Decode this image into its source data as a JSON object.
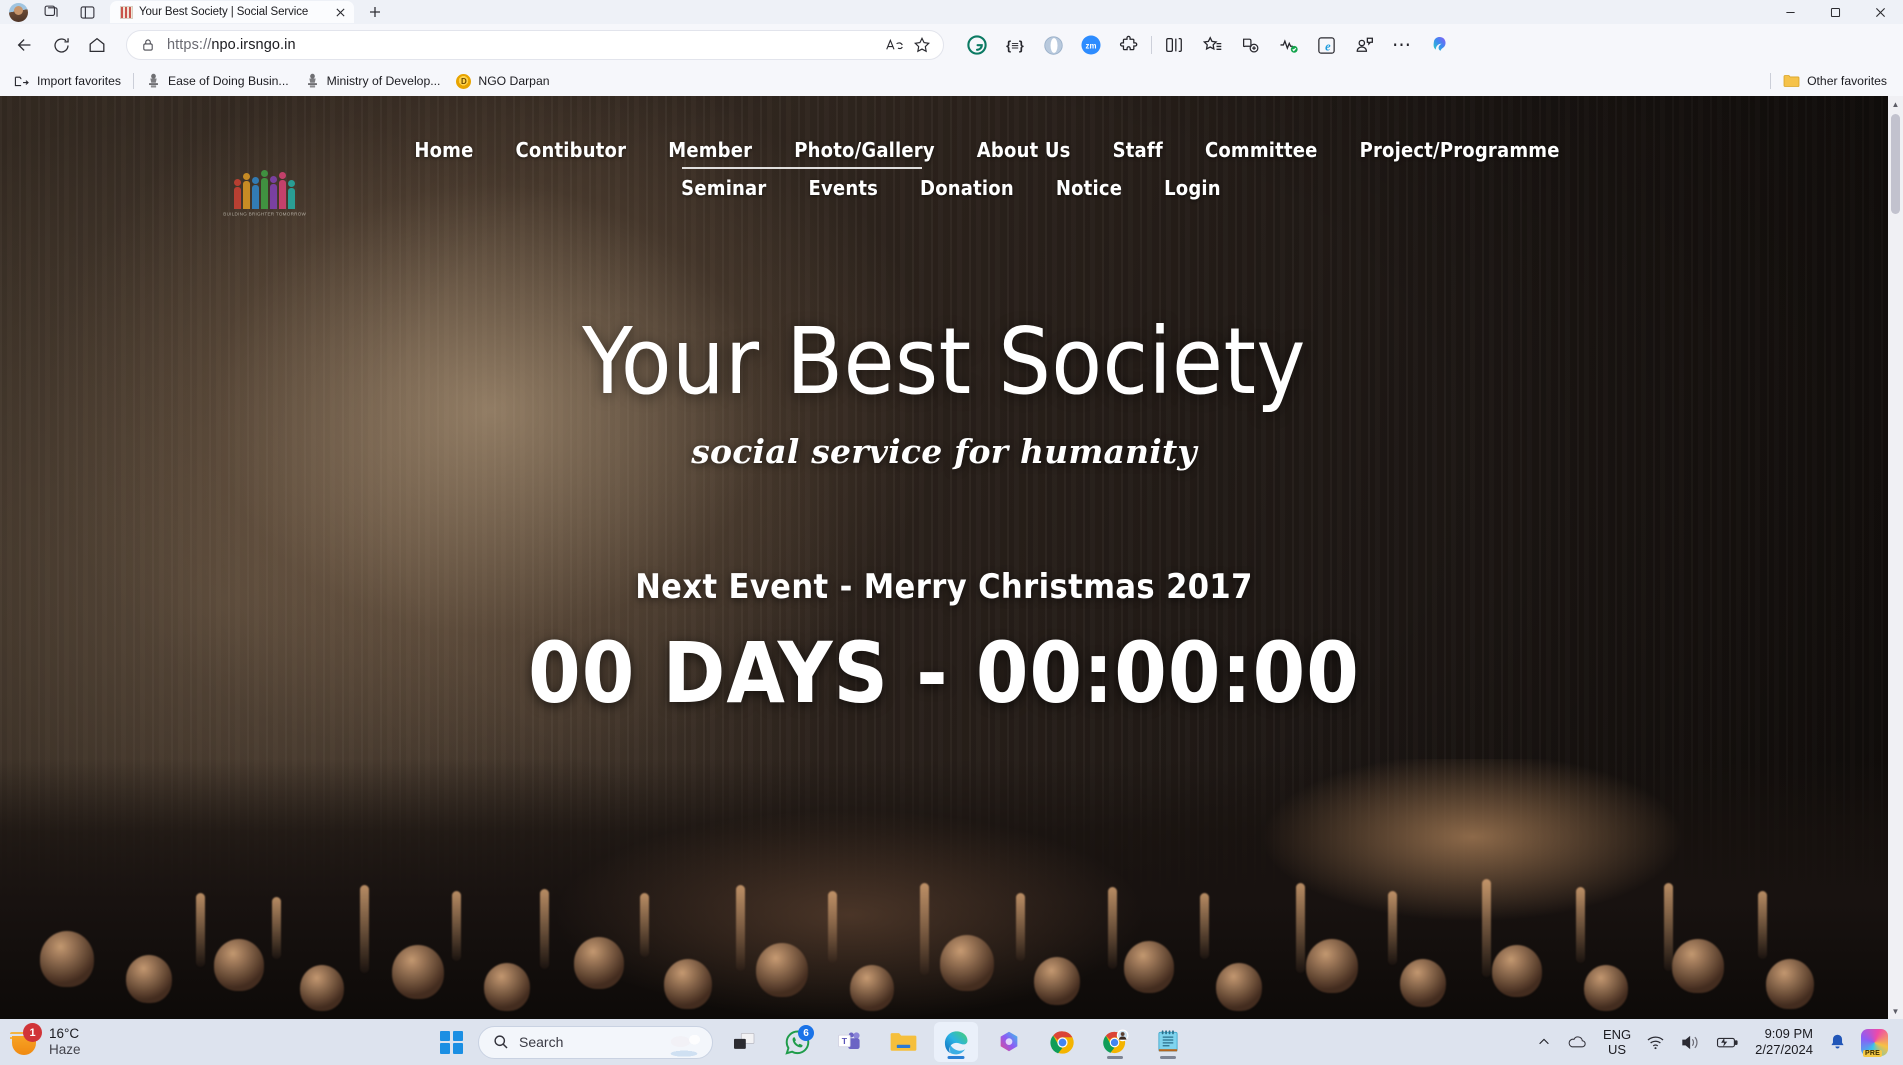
{
  "browser": {
    "tab": {
      "title": "Your Best Society | Social Service",
      "favicon": "site-favicon"
    },
    "new_tab_label": "+",
    "window_controls": {
      "minimize": "—",
      "maximize": "☐",
      "close": "✕"
    },
    "address": {
      "url_scheme": "https://",
      "url_host": "npo.irsngo.in",
      "full": "https://npo.irsngo.in",
      "lock": "site-lock-icon"
    },
    "omnibox_actions": [
      {
        "name": "read-aloud-icon",
        "label": "Aᴺ"
      },
      {
        "name": "add-favorite-icon",
        "label": "☆"
      }
    ],
    "extensions": [
      {
        "name": "grammarly-extension",
        "label": "G"
      },
      {
        "name": "json-formatter-extension",
        "label": "{≡}"
      },
      {
        "name": "blue-circle-extension",
        "label": ""
      },
      {
        "name": "zoom-extension",
        "label": "zm"
      },
      {
        "name": "extensions-puzzle-icon",
        "label": ""
      },
      {
        "name": "split-screen-icon",
        "label": ""
      },
      {
        "name": "favorites-icon",
        "label": ""
      },
      {
        "name": "collections-icon",
        "label": ""
      },
      {
        "name": "browser-essentials-icon",
        "label": ""
      },
      {
        "name": "ie-mode-icon",
        "label": "e"
      },
      {
        "name": "profile-icon",
        "label": ""
      },
      {
        "name": "settings-more-icon",
        "label": "⋯"
      },
      {
        "name": "copilot-icon",
        "label": ""
      }
    ],
    "bookmarks": {
      "items": [
        {
          "label": "Import favorites",
          "icon": "import-favorites-icon"
        },
        {
          "label": "Ease of Doing Busin...",
          "icon": "emblem-of-india-icon"
        },
        {
          "label": "Ministry of Develop...",
          "icon": "emblem-of-india-icon"
        },
        {
          "label": "NGO Darpan",
          "icon": "ngo-darpan-icon"
        }
      ],
      "other_favorites": {
        "label": "Other favorites",
        "icon": "folder-icon"
      }
    }
  },
  "site": {
    "logo_caption": "BUILDING BRIGHTER TOMORROW",
    "nav_row1": [
      {
        "label": "Home"
      },
      {
        "label": "Contibutor"
      },
      {
        "label": "Member"
      },
      {
        "label": "Photo/Gallery"
      },
      {
        "label": "About Us"
      },
      {
        "label": "Staff"
      },
      {
        "label": "Committee"
      },
      {
        "label": "Project/Programme"
      }
    ],
    "nav_row2": [
      {
        "label": "Seminar"
      },
      {
        "label": "Events"
      },
      {
        "label": "Donation"
      },
      {
        "label": "Notice"
      },
      {
        "label": "Login"
      }
    ],
    "hero": {
      "title": "Your Best Society",
      "tagline": "social service for humanity",
      "event_line": "Next Event - Merry Christmas 2017",
      "countdown": "00 DAYS - 00:00:00"
    }
  },
  "taskbar": {
    "weather": {
      "temperature": "16°C",
      "condition": "Haze",
      "badge": "1"
    },
    "search": {
      "placeholder": "Search",
      "icon": "search-icon"
    },
    "start": {
      "name": "start-button"
    },
    "apps": [
      {
        "name": "task-view-button",
        "label": "",
        "running": false
      },
      {
        "name": "whatsapp-button",
        "label": "",
        "badge": "6",
        "running": false
      },
      {
        "name": "teams-button",
        "label": "T",
        "running": false
      },
      {
        "name": "file-explorer-button",
        "label": "",
        "running": false
      },
      {
        "name": "edge-button",
        "label": "",
        "running": true,
        "active": true
      },
      {
        "name": "microsoft-365-button",
        "label": "",
        "running": false
      },
      {
        "name": "chrome-button",
        "label": "",
        "running": false
      },
      {
        "name": "chrome-profile-button",
        "label": "",
        "running": true
      },
      {
        "name": "notepad-button",
        "label": "",
        "running": true
      }
    ],
    "tray": {
      "show_hidden": "⌃",
      "cloud": "onedrive-icon",
      "language": {
        "line1": "ENG",
        "line2": "US"
      },
      "wifi": "wifi-icon",
      "volume": "volume-icon",
      "battery": "battery-charging-icon",
      "time": "9:09 PM",
      "date": "2/27/2024",
      "notifications": "bell-icon",
      "copilot_badge": "PRE"
    }
  }
}
